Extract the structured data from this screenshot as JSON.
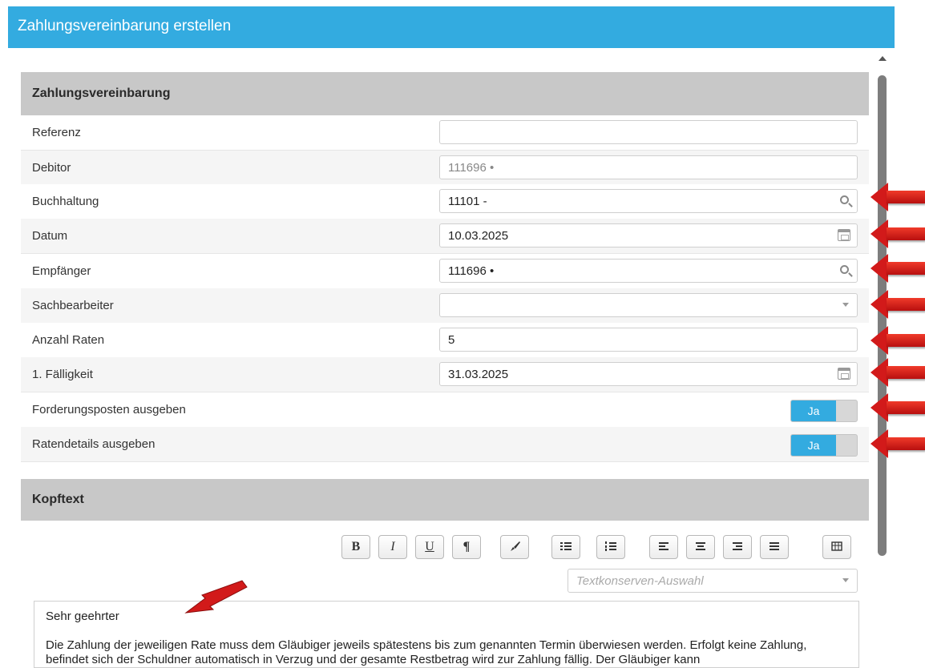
{
  "dialog": {
    "title": "Zahlungsvereinbarung erstellen"
  },
  "section_main": {
    "title": "Zahlungsvereinbarung"
  },
  "fields": [
    {
      "label": "Referenz",
      "value": ""
    },
    {
      "label": "Debitor",
      "value": "111696 •"
    },
    {
      "label": "Buchhaltung",
      "value": "11101 -"
    },
    {
      "label": "Datum",
      "value": "10.03.2025"
    },
    {
      "label": "Empfänger",
      "value": "111696 •"
    },
    {
      "label": "Sachbearbeiter",
      "value": ""
    },
    {
      "label": "Anzahl Raten",
      "value": "5"
    },
    {
      "label": "1. Fälligkeit",
      "value": "31.03.2025"
    },
    {
      "label": "Forderungsposten ausgeben",
      "toggle": "Ja"
    },
    {
      "label": "Ratendetails ausgeben",
      "toggle": "Ja"
    }
  ],
  "section_header_text": {
    "title": "Kopftext"
  },
  "toolbar": {
    "bold": "B",
    "italic": "I",
    "underline": "U",
    "paragraph": "¶",
    "brush": "🖌",
    "bullets": "☰",
    "numbers": "☷",
    "align_left": "≡",
    "align_center": "≡",
    "align_right": "≡",
    "justify": "≡",
    "table": "▦"
  },
  "snippet": {
    "placeholder": "Textkonserven-Auswahl"
  },
  "editor": {
    "greeting": "Sehr geehrter",
    "body": "Die Zahlung der jeweiligen Rate muss dem Gläubiger jeweils spätestens bis zum genannten Termin überwiesen werden. Erfolgt keine Zahlung, befindet sich der Schuldner automatisch in Verzug und der gesamte Restbetrag wird zur Zahlung fällig. Der Gläubiger kann"
  },
  "colors": {
    "accent": "#33abe0",
    "arrow": "#d21a1a"
  }
}
